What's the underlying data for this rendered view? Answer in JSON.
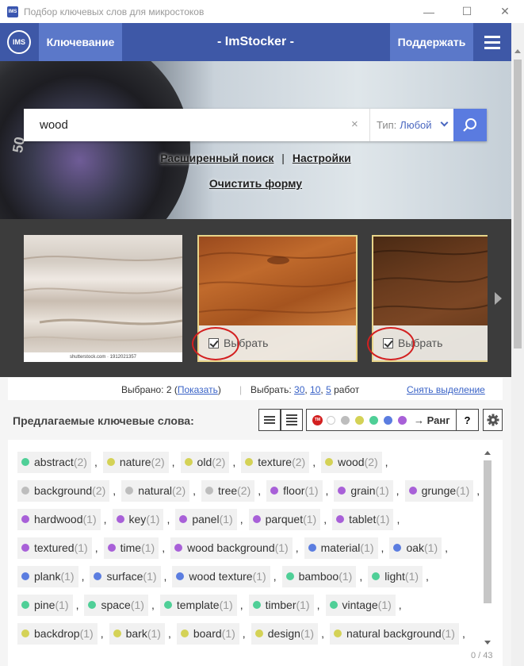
{
  "window": {
    "icon_text": "IMS",
    "title": "Подбор ключевых слов для микростоков",
    "minimize": "—",
    "maximize": "☐",
    "close": "✕"
  },
  "header": {
    "logo": "IMS",
    "nav_keywords": "Ключевание",
    "brand": "- ImStocker -",
    "support": "Поддержать"
  },
  "hero": {
    "lens_text": "50",
    "search": {
      "value": "wood",
      "clear": "×",
      "type_label": "Тип:",
      "type_value": "Любой"
    },
    "link_advanced": "Расширенный поиск",
    "separator": "|",
    "link_settings": "Настройки",
    "link_clear": "Очистить форму"
  },
  "gallery": {
    "caption": "shutterstock.com · 1912021357",
    "select_label": "Выбрать"
  },
  "selection": {
    "selected_prefix": "Выбрано: 2 (",
    "show_link": "Показать",
    "selected_suffix": ")",
    "divider": "|",
    "pick_prefix": "Выбрать:",
    "pick_30": "30",
    "pick_10": "10",
    "pick_5": "5",
    "pick_suffix": "работ",
    "unselect": "Снять выделение"
  },
  "keywords": {
    "title": "Предлагаемые ключевые слова:",
    "tm": "TM",
    "color_filters": [
      "#ffffff",
      "#bdbdbd",
      "#d4d256",
      "#4fcf97",
      "#5b7de0",
      "#a860d8"
    ],
    "rank": "→ Ранг",
    "help": "?",
    "counter": "0 / 43",
    "rows": [
      [
        {
          "word": "abstract",
          "count": "(2)",
          "color": "#4fcf97"
        },
        {
          "word": "nature",
          "count": "(2)",
          "color": "#d4d256"
        },
        {
          "word": "old",
          "count": "(2)",
          "color": "#d4d256"
        },
        {
          "word": "texture",
          "count": "(2)",
          "color": "#d4d256"
        },
        {
          "word": "wood",
          "count": "(2)",
          "color": "#d4d256"
        }
      ],
      [
        {
          "word": "background",
          "count": "(2)",
          "color": "#bdbdbd"
        },
        {
          "word": "natural",
          "count": "(2)",
          "color": "#bdbdbd"
        },
        {
          "word": "tree",
          "count": "(2)",
          "color": "#bdbdbd"
        },
        {
          "word": "floor",
          "count": "(1)",
          "color": "#a860d8"
        },
        {
          "word": "grain",
          "count": "(1)",
          "color": "#a860d8"
        },
        {
          "word": "grunge",
          "count": "(1)",
          "color": "#a860d8"
        }
      ],
      [
        {
          "word": "hardwood",
          "count": "(1)",
          "color": "#a860d8"
        },
        {
          "word": "key",
          "count": "(1)",
          "color": "#a860d8"
        },
        {
          "word": "panel",
          "count": "(1)",
          "color": "#a860d8"
        },
        {
          "word": "parquet",
          "count": "(1)",
          "color": "#a860d8"
        },
        {
          "word": "tablet",
          "count": "(1)",
          "color": "#a860d8"
        }
      ],
      [
        {
          "word": "textured",
          "count": "(1)",
          "color": "#a860d8"
        },
        {
          "word": "time",
          "count": "(1)",
          "color": "#a860d8"
        },
        {
          "word": "wood background",
          "count": "(1)",
          "color": "#a860d8"
        },
        {
          "word": "material",
          "count": "(1)",
          "color": "#5b7de0"
        },
        {
          "word": "oak",
          "count": "(1)",
          "color": "#5b7de0"
        }
      ],
      [
        {
          "word": "plank",
          "count": "(1)",
          "color": "#5b7de0"
        },
        {
          "word": "surface",
          "count": "(1)",
          "color": "#5b7de0"
        },
        {
          "word": "wood texture",
          "count": "(1)",
          "color": "#5b7de0"
        },
        {
          "word": "bamboo",
          "count": "(1)",
          "color": "#4fcf97"
        },
        {
          "word": "light",
          "count": "(1)",
          "color": "#4fcf97"
        }
      ],
      [
        {
          "word": "pine",
          "count": "(1)",
          "color": "#4fcf97"
        },
        {
          "word": "space",
          "count": "(1)",
          "color": "#4fcf97"
        },
        {
          "word": "template",
          "count": "(1)",
          "color": "#4fcf97"
        },
        {
          "word": "timber",
          "count": "(1)",
          "color": "#4fcf97"
        },
        {
          "word": "vintage",
          "count": "(1)",
          "color": "#4fcf97"
        }
      ],
      [
        {
          "word": "backdrop",
          "count": "(1)",
          "color": "#d4d256"
        },
        {
          "word": "bark",
          "count": "(1)",
          "color": "#d4d256"
        },
        {
          "word": "board",
          "count": "(1)",
          "color": "#d4d256"
        },
        {
          "word": "design",
          "count": "(1)",
          "color": "#d4d256"
        },
        {
          "word": "natural background",
          "count": "(1)",
          "color": "#d4d256"
        }
      ]
    ]
  }
}
